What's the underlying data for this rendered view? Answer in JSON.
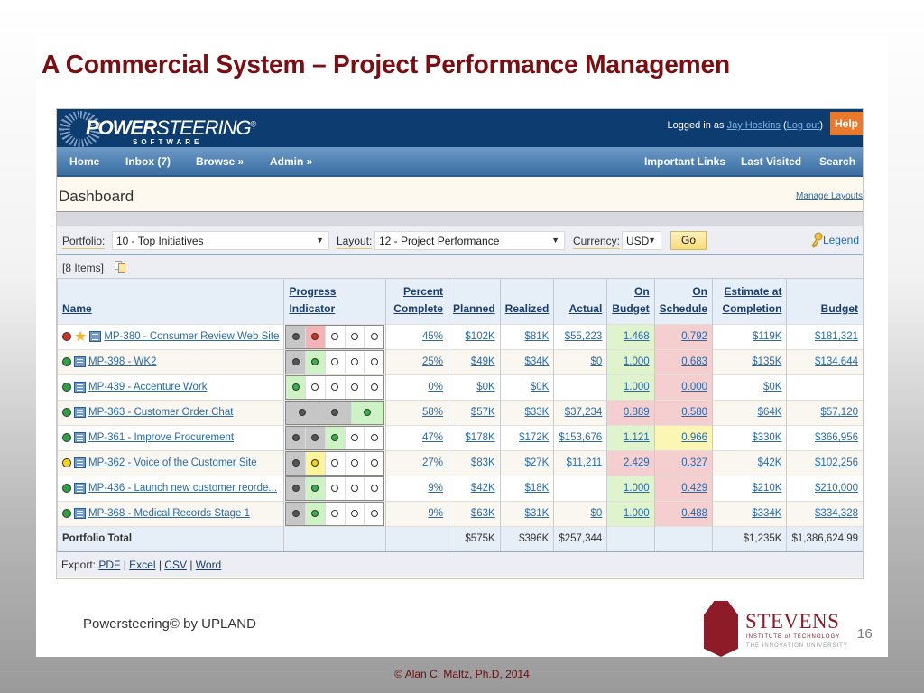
{
  "slide": {
    "title": "A Commercial System – Project Performance Managemen",
    "footer_credit": "Powersteering© by UPLAND",
    "page_number": "16",
    "copyright": "© Alan C. Maltz, Ph.D, 2014",
    "logo": {
      "name": "STEVENS",
      "line1": "INSTITUTE of TECHNOLOGY",
      "line2": "THE INNOVATION UNIVERSITY"
    }
  },
  "app": {
    "brand": {
      "bold": "POWER",
      "thin": "STEERING",
      "mark": "®",
      "sub": "SOFTWARE"
    },
    "login": {
      "prefix": "Logged in as ",
      "user": "Jay Hoskins",
      "open": " (",
      "logout": "Log out",
      "close": ")"
    },
    "help_label": "Help",
    "nav_left": [
      "Home",
      "Inbox (7)",
      "Browse »",
      "Admin »"
    ],
    "nav_right": [
      "Important Links",
      "Last Visited",
      "Search"
    ],
    "page_title": "Dashboard",
    "manage_layouts": "Manage Layouts",
    "filters": {
      "portfolio_label": "Portfolio:",
      "portfolio_value": "10 - Top Initiatives",
      "layout_label": "Layout:",
      "layout_value": "12 - Project Performance",
      "currency_label": "Currency:",
      "currency_value": "USD",
      "go_label": "Go",
      "legend_label": "Legend"
    },
    "items_count": "[8 Items]",
    "columns": {
      "name": "Name",
      "progress": "Progress Indicator",
      "percent1": "Percent",
      "percent2": "Complete",
      "planned": "Planned",
      "realized": "Realized",
      "actual": "Actual",
      "onbudget1": "On",
      "onbudget2": "Budget",
      "onschedule1": "On",
      "onschedule2": "Schedule",
      "eac1": "Estimate at",
      "eac2": "Completion",
      "budget": "Budget"
    },
    "rows": [
      {
        "status": "red",
        "star": true,
        "name": "MP-380 - Consumer Review Web Site",
        "progress": [
          "done",
          "red",
          "empty",
          "empty",
          "empty"
        ],
        "percent": "45%",
        "planned": "$102K",
        "realized": "$81K",
        "actual": "$55,223",
        "on_budget": "1.468",
        "on_budget_status": "green",
        "on_schedule": "0.792",
        "on_schedule_status": "red",
        "eac": "$119K",
        "budget": "$181,321"
      },
      {
        "status": "green",
        "star": false,
        "name": "MP-398 - WK2",
        "progress": [
          "done",
          "green",
          "empty",
          "empty",
          "empty"
        ],
        "percent": "25%",
        "planned": "$49K",
        "realized": "$34K",
        "actual": "$0",
        "on_budget": "1.000",
        "on_budget_status": "green",
        "on_schedule": "0.683",
        "on_schedule_status": "red",
        "eac": "$135K",
        "budget": "$134,644"
      },
      {
        "status": "green",
        "star": false,
        "name": "MP-439 - Accenture Work",
        "progress": [
          "green",
          "empty",
          "empty",
          "empty",
          "empty"
        ],
        "percent": "0%",
        "planned": "$0K",
        "realized": "$0K",
        "actual": "",
        "on_budget": "1.000",
        "on_budget_status": "green",
        "on_schedule": "0.000",
        "on_schedule_status": "red",
        "eac": "$0K",
        "budget": ""
      },
      {
        "status": "green",
        "star": false,
        "name": "MP-363 - Customer Order Chat",
        "progress": [
          "done",
          "done",
          "green"
        ],
        "percent": "58%",
        "planned": "$57K",
        "realized": "$33K",
        "actual": "$37,234",
        "on_budget": "0.889",
        "on_budget_status": "red",
        "on_schedule": "0.580",
        "on_schedule_status": "red",
        "eac": "$64K",
        "budget": "$57,120"
      },
      {
        "status": "green",
        "star": false,
        "name": "MP-361 - Improve Procurement",
        "progress": [
          "done",
          "done",
          "green",
          "empty",
          "empty"
        ],
        "percent": "47%",
        "planned": "$178K",
        "realized": "$172K",
        "actual": "$153,676",
        "on_budget": "1.121",
        "on_budget_status": "green",
        "on_schedule": "0.966",
        "on_schedule_status": "yellow",
        "eac": "$330K",
        "budget": "$366,956"
      },
      {
        "status": "yellow",
        "star": false,
        "name": "MP-362 - Voice of the Customer Site",
        "progress": [
          "done",
          "yellow",
          "empty",
          "empty",
          "empty"
        ],
        "percent": "27%",
        "planned": "$83K",
        "realized": "$27K",
        "actual": "$11,211",
        "on_budget": "2.429",
        "on_budget_status": "red",
        "on_schedule": "0.327",
        "on_schedule_status": "red",
        "eac": "$42K",
        "budget": "$102,256"
      },
      {
        "status": "green",
        "star": false,
        "name": "MP-436 - Launch new customer reorde...",
        "progress": [
          "done",
          "green",
          "empty",
          "empty",
          "empty"
        ],
        "percent": "9%",
        "planned": "$42K",
        "realized": "$18K",
        "actual": "",
        "on_budget": "1.000",
        "on_budget_status": "green",
        "on_schedule": "0.429",
        "on_schedule_status": "red",
        "eac": "$210K",
        "budget": "$210,000"
      },
      {
        "status": "green",
        "star": false,
        "name": "MP-368 - Medical Records Stage 1",
        "progress": [
          "done",
          "green",
          "empty",
          "empty",
          "empty"
        ],
        "percent": "9%",
        "planned": "$63K",
        "realized": "$31K",
        "actual": "$0",
        "on_budget": "1.000",
        "on_budget_status": "green",
        "on_schedule": "0.488",
        "on_schedule_status": "red",
        "eac": "$334K",
        "budget": "$334,328"
      }
    ],
    "total": {
      "label": "Portfolio Total",
      "planned": "$575K",
      "realized": "$396K",
      "actual": "$257,344",
      "eac": "$1,235K",
      "budget": "$1,386,624.99"
    },
    "export": {
      "label": "Export:",
      "links": [
        "PDF",
        "Excel",
        "CSV",
        "Word"
      ]
    }
  }
}
